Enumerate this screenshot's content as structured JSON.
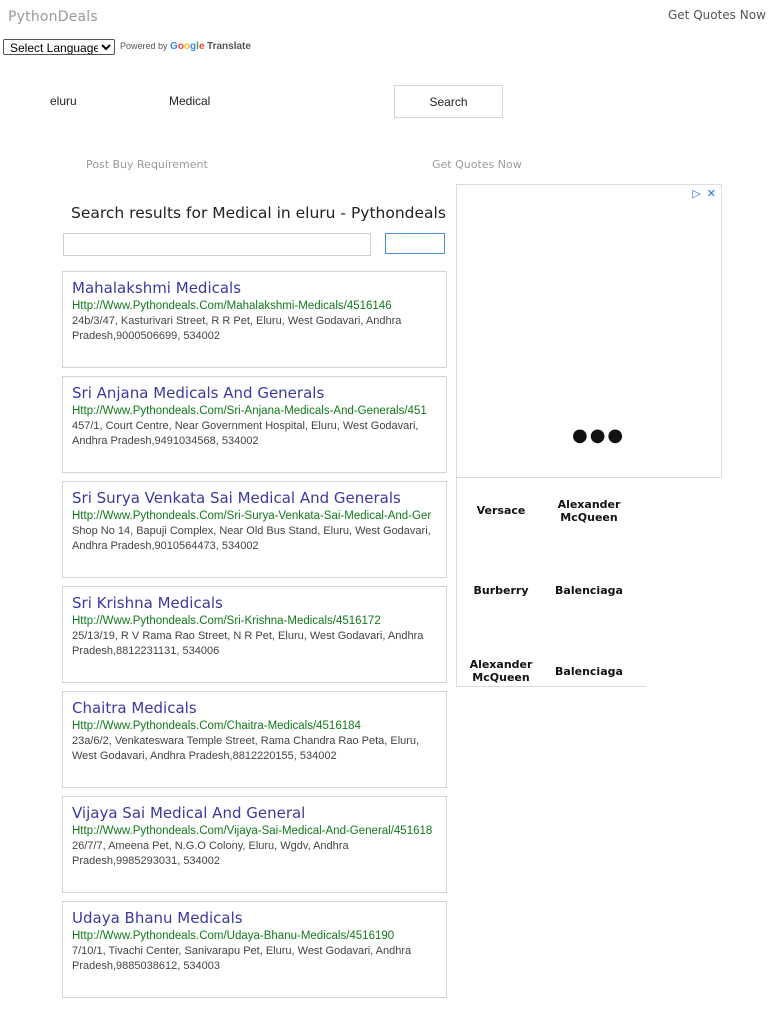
{
  "header": {
    "logo": "PythonDeals",
    "get_quotes": "Get Quotes Now"
  },
  "translate": {
    "select_language": "Select Language",
    "powered_by": "Powered by",
    "google": "Google",
    "translate_word": "Translate"
  },
  "search": {
    "city": "eluru",
    "keyword": "Medical",
    "button": "Search"
  },
  "nav": {
    "post_requirement": "Post Buy Requirement",
    "get_quotes": "Get Quotes Now"
  },
  "results_title": "Search results for Medical in eluru - Pythondeals",
  "results": [
    {
      "name": "Mahalakshmi Medicals",
      "url": "Http://Www.Pythondeals.Com/Mahalakshmi-Medicals/4516146",
      "address": "24b/3/47, Kasturivari Street, R R Pet, Eluru, West Godavari, Andhra Pradesh,9000506699, 534002"
    },
    {
      "name": "Sri Anjana Medicals And Generals",
      "url": "Http://Www.Pythondeals.Com/Sri-Anjana-Medicals-And-Generals/451",
      "address": "457/1, Court Centre, Near Government Hospital, Eluru, West Godavari, Andhra Pradesh,9491034568, 534002"
    },
    {
      "name": "Sri Surya Venkata Sai Medical And Generals",
      "url": "Http://Www.Pythondeals.Com/Sri-Surya-Venkata-Sai-Medical-And-Ger",
      "address": "Shop No 14, Bapuji Complex, Near Old Bus Stand, Eluru, West Godavari, Andhra Pradesh,9010564473, 534002"
    },
    {
      "name": "Sri Krishna Medicals",
      "url": "Http://Www.Pythondeals.Com/Sri-Krishna-Medicals/4516172",
      "address": "25/13/19, R V Rama Rao Street, N R Pet, Eluru, West Godavari, Andhra Pradesh,8812231131, 534006"
    },
    {
      "name": "Chaitra Medicals",
      "url": "Http://Www.Pythondeals.Com/Chaitra-Medicals/4516184",
      "address": "23a/6/2, Venkateswara Temple Street, Rama Chandra Rao Peta, Eluru, West Godavari, Andhra Pradesh,8812220155, 534002"
    },
    {
      "name": "Vijaya Sai Medical And General",
      "url": "Http://Www.Pythondeals.Com/Vijaya-Sai-Medical-And-General/451618",
      "address": "26/7/7, Ameena Pet, N.G.O Colony, Eluru, Wgdv, Andhra Pradesh,9985293031, 534002"
    },
    {
      "name": "Udaya Bhanu Medicals",
      "url": "Http://Www.Pythondeals.Com/Udaya-Bhanu-Medicals/4516190",
      "address": "7/10/1, Tivachi Center, Sanivarapu Pet, Eluru, West Godavari, Andhra Pradesh,9885038612, 534003"
    }
  ],
  "ad": {
    "brands": [
      "Versace",
      "Alexander McQueen",
      "Burberry",
      "Balenciaga",
      "Alexander McQueen",
      "Balenciaga"
    ]
  }
}
